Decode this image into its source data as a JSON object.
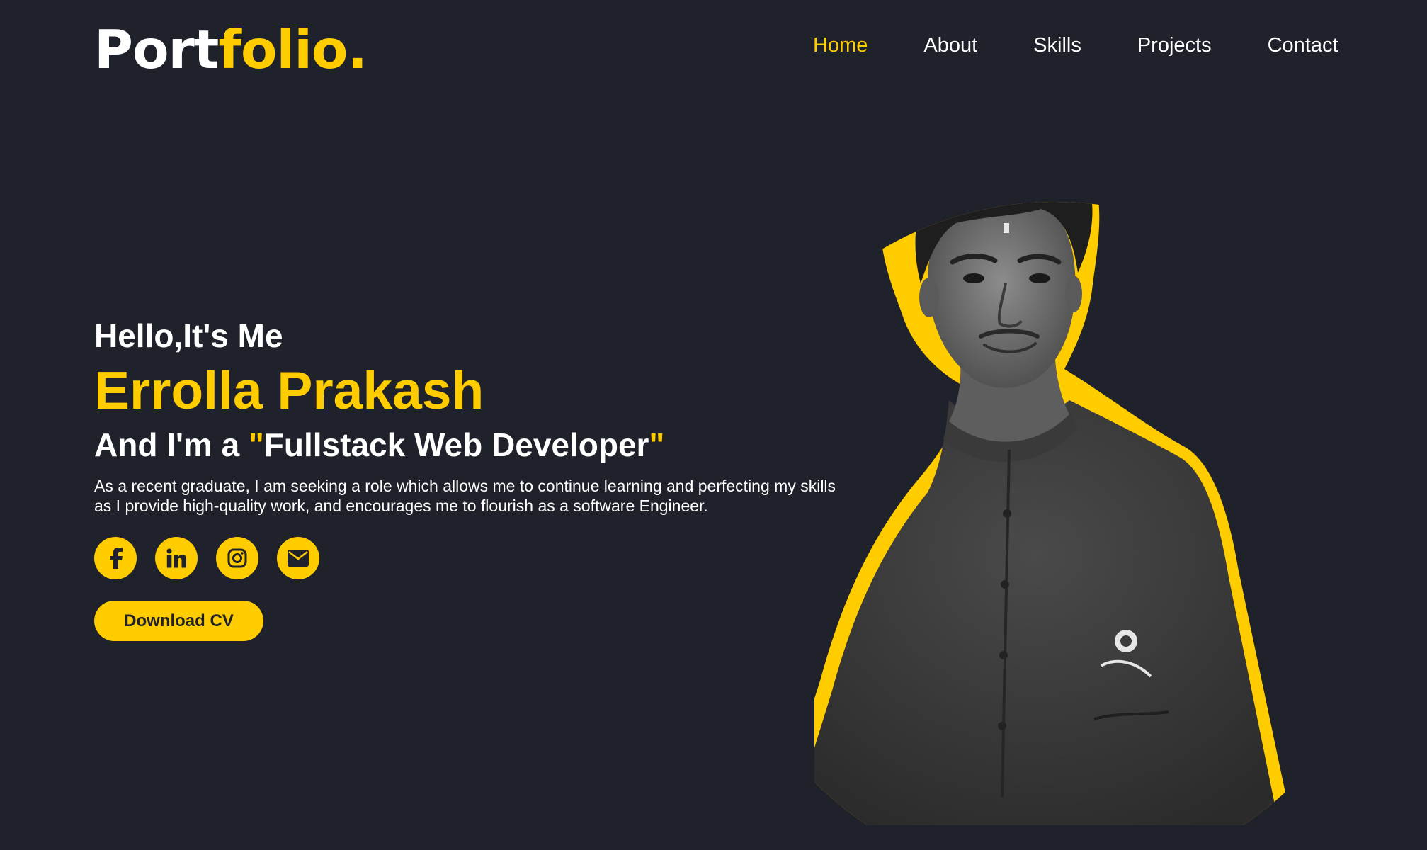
{
  "header": {
    "logo_main": "Port",
    "logo_accent": "folio.",
    "nav": [
      {
        "label": "Home",
        "active": true
      },
      {
        "label": "About",
        "active": false
      },
      {
        "label": "Skills",
        "active": false
      },
      {
        "label": "Projects",
        "active": false
      },
      {
        "label": "Contact",
        "active": false
      }
    ]
  },
  "hero": {
    "greeting": "Hello,It's Me",
    "name": "Errolla Prakash",
    "role_prefix": "And I'm a ",
    "role_quote_open": "\"",
    "role_title": "Fullstack Web Developer",
    "role_quote_close": "\"",
    "description": "As a recent graduate, I am seeking a role which allows me to continue learning and perfecting my skills as I provide high-quality work, and encourages me to flourish as a software Engineer.",
    "cv_label": "Download CV"
  },
  "socials": [
    {
      "icon": "facebook-icon"
    },
    {
      "icon": "linkedin-icon"
    },
    {
      "icon": "instagram-icon"
    },
    {
      "icon": "envelope-icon"
    }
  ],
  "colors": {
    "background": "#1f222b",
    "accent": "#ffcc00",
    "text": "#ffffff"
  }
}
